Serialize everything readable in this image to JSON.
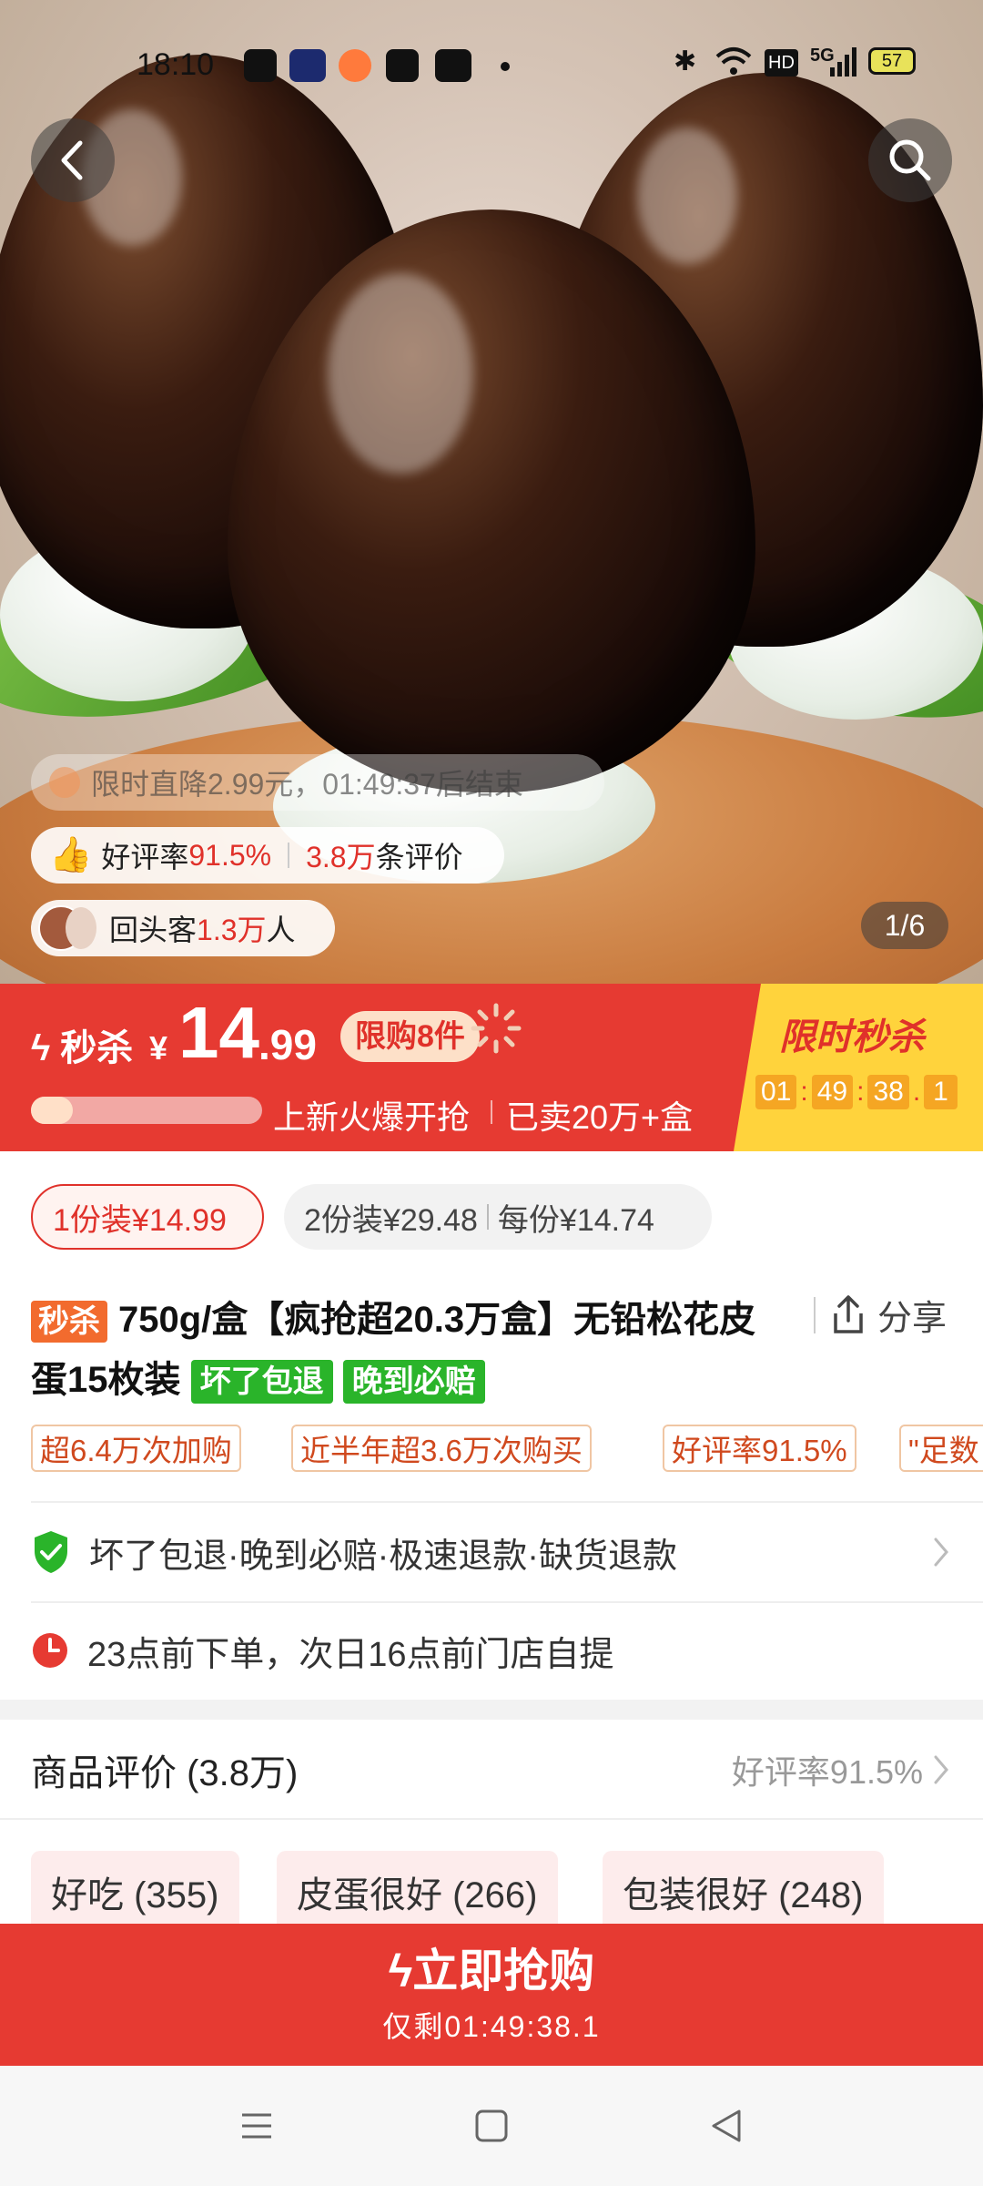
{
  "status_bar": {
    "time": "18:10",
    "battery": "57",
    "network": "5G"
  },
  "hero": {
    "image_counter": "1/6",
    "promo_notice": "限时直降2.99元，01:49:37后结束",
    "rating_label": "好评率",
    "rating_value": "91.5%",
    "review_count_value": "3.8万",
    "review_count_suffix": "条评价",
    "repeat_label": "回头客",
    "repeat_value": "1.3万",
    "repeat_suffix": "人"
  },
  "flash_sale": {
    "label": "秒杀",
    "currency": "¥",
    "price_int": "14",
    "price_dec": ".99",
    "limit": "限购8件",
    "progress_percent": 18,
    "slogan": "上新火爆开抢",
    "sold": "已卖20万+盒",
    "title": "限时秒杀",
    "countdown": [
      "01",
      "49",
      "38",
      "1"
    ]
  },
  "options": {
    "option1": "1份装¥14.99",
    "option2_a": "2份装¥29.48",
    "option2_b": "每份¥14.74"
  },
  "product": {
    "badge": "秒杀",
    "title_line1": "750g/盒【疯抢超20.3万盒】无铅松花皮",
    "title_line2": "蛋15枚装",
    "badge_green1": "坏了包退",
    "badge_green2": "晚到必赔",
    "share": "分享"
  },
  "chips": [
    "超6.4万次加购",
    "近半年超3.6万次购买",
    "好评率91.5%",
    "\"足数"
  ],
  "guarantee": "坏了包退·晚到必赔·极速退款·缺货退款",
  "delivery": "23点前下单，次日16点前门店自提",
  "reviews": {
    "title": "商品评价 (3.8万)",
    "rating": "好评率91.5%",
    "tags": [
      "好吃 (355)",
      "皮蛋很好 (266)",
      "包装很好 (248)"
    ]
  },
  "buy": {
    "label": "立即抢购",
    "remaining": "仅剩01:49:38.1"
  },
  "colors": {
    "accent_red": "#e63a32",
    "flash_yellow": "#ffd33c",
    "green_badge": "#2ab42a"
  }
}
